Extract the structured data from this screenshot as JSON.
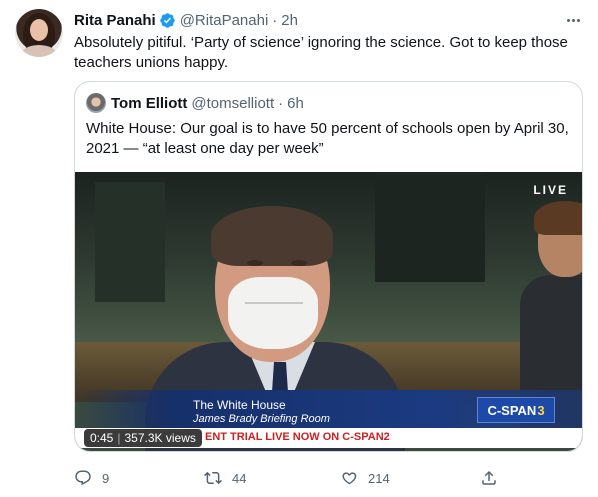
{
  "tweet": {
    "author": {
      "display_name": "Rita Panahi",
      "handle": "@RitaPanahi",
      "time": "2h",
      "dot": "·"
    },
    "text": "Absolutely pitiful. ‘Party of science’ ignoring the science. Got to keep those teachers unions happy.",
    "icons": {
      "verified": "verified-badge-icon",
      "more": "more-options-icon"
    },
    "colors": {
      "verified": "#1d9bf0",
      "secondary_text": "#536471",
      "border": "#cfd9de"
    }
  },
  "quote": {
    "author": {
      "display_name": "Tom Elliott",
      "handle": "@tomselliott",
      "time": "6h",
      "dot": "·"
    },
    "text": "White House: Our goal is to have 50 percent of schools open by April 30, 2021 — “at least one day per week”",
    "video": {
      "live_label": "LIVE",
      "lower_third_title": "The White House",
      "lower_third_subtitle": "James Brady Briefing Room",
      "network_logo_text": "C-SPAN",
      "network_logo_number": "3",
      "ticker": "ENT TRIAL LIVE NOW ON C-SPAN2",
      "duration": "0:45",
      "separator": "|",
      "views": "357.3K views"
    }
  },
  "actions": {
    "reply": {
      "icon": "reply-icon",
      "count": "9"
    },
    "retweet": {
      "icon": "retweet-icon",
      "count": "44"
    },
    "like": {
      "icon": "like-icon",
      "count": "214"
    },
    "share": {
      "icon": "share-icon"
    }
  }
}
